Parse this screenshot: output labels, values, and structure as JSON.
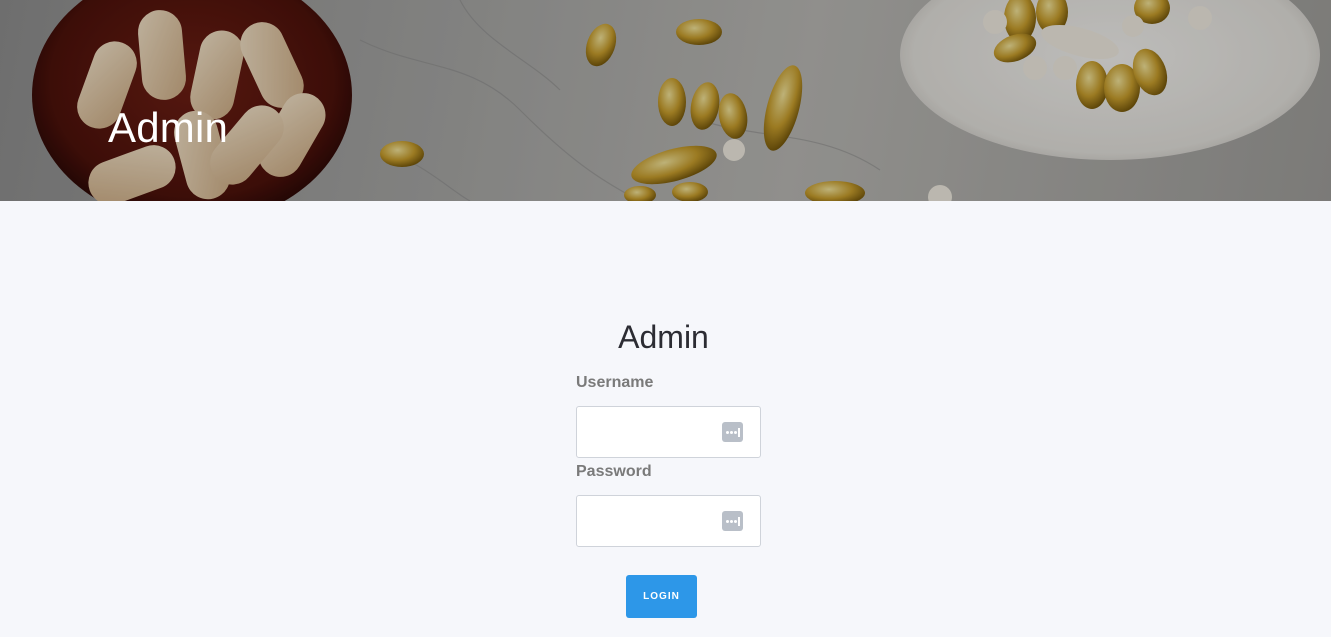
{
  "hero": {
    "title": "Admin"
  },
  "login": {
    "title": "Admin",
    "username_label": "Username",
    "username_value": "",
    "password_label": "Password",
    "password_value": "",
    "button_label": "LOGIN"
  },
  "icons": {
    "field_icon": "password-manager-icon"
  },
  "colors": {
    "page_background": "#f6f7fb",
    "accent": "#2d97e8",
    "title_text": "#2c2c33",
    "label_text": "#7a7a7a"
  }
}
